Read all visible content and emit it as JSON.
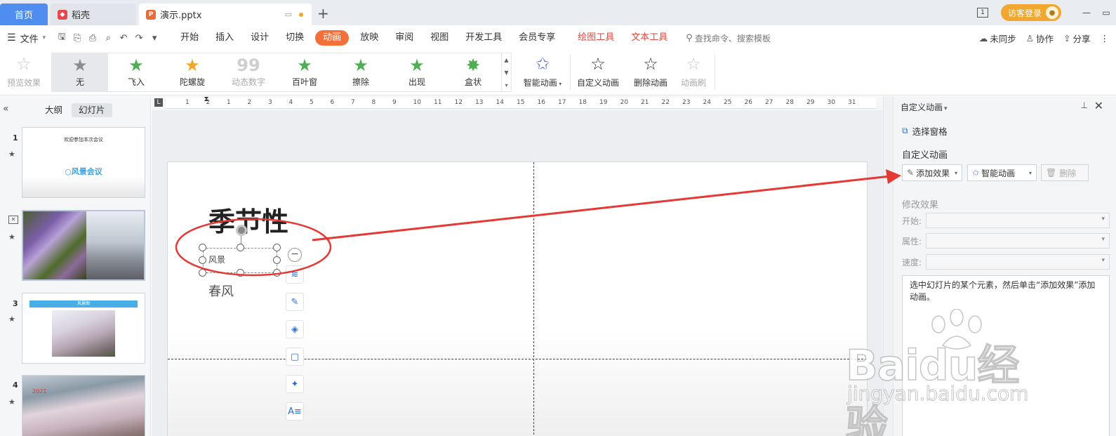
{
  "titlebar": {
    "tab_home": "首页",
    "tab_docer": "稻壳",
    "tab_file": "演示.pptx",
    "visitor_login": "访客登录"
  },
  "menubar": {
    "file": "文件",
    "tabs": [
      "开始",
      "插入",
      "设计",
      "切换",
      "动画",
      "放映",
      "审阅",
      "视图",
      "开发工具",
      "会员专享"
    ],
    "context_tabs": [
      "绘图工具",
      "文本工具"
    ],
    "search_placeholder": "查找命令、搜索模板",
    "right": {
      "sync": "未同步",
      "collab": "协作",
      "share": "分享"
    }
  },
  "ribbon": {
    "preview": "预览效果",
    "gallery": [
      "无",
      "飞入",
      "陀螺旋",
      "动态数字",
      "百叶窗",
      "擦除",
      "出现",
      "盒状"
    ],
    "smart_animation": "智能动画",
    "custom_animation": "自定义动画",
    "delete_animation": "删除动画",
    "animation_painter": "动画刷"
  },
  "left_panel": {
    "tab_outline": "大纲",
    "tab_slides": "幻灯片",
    "slides": [
      {
        "num": "1",
        "title": "欢迎参加本次会议",
        "subtitle": "○风景会议"
      },
      {
        "num": "2"
      },
      {
        "num": "3",
        "bar_text": "风景图"
      },
      {
        "num": "4",
        "year": "2021"
      }
    ]
  },
  "ruler": {
    "numbers": [
      "1",
      "2",
      "1",
      "2",
      "3",
      "4",
      "5",
      "6",
      "7",
      "8",
      "9",
      "10",
      "11",
      "12",
      "13",
      "14",
      "15",
      "16",
      "17",
      "18",
      "19",
      "20",
      "21",
      "22",
      "23",
      "24",
      "25",
      "26",
      "27",
      "28",
      "29",
      "30",
      "31"
    ]
  },
  "slide": {
    "title": "季节性",
    "text1": "风景",
    "text2": "春风"
  },
  "right_panel": {
    "header": "自定义动画",
    "selection_pane": "选择窗格",
    "section_title": "自定义动画",
    "add_effect": "添加效果",
    "smart_animation": "智能动画",
    "delete": "删除",
    "modify_effect": "修改效果",
    "start_label": "开始:",
    "property_label": "属性:",
    "speed_label": "速度:",
    "hint": "选中幻灯片的某个元素，然后单击“添加效果”添加动画。"
  },
  "watermark": {
    "logo": "Baidu经验",
    "url": "jingyan.baidu.com"
  },
  "colors": {
    "accent": "#f3703a",
    "home_tab": "#4f8df0",
    "annotation": "#e53935",
    "context_tab": "#e2473b"
  }
}
